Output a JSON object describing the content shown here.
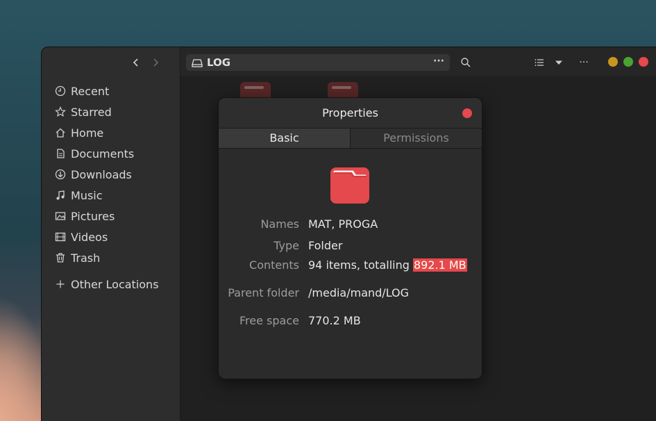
{
  "sidebar": {
    "places": [
      {
        "label": "Recent",
        "icon": "clock-icon"
      },
      {
        "label": "Starred",
        "icon": "star-icon"
      },
      {
        "label": "Home",
        "icon": "home-icon"
      },
      {
        "label": "Documents",
        "icon": "document-icon"
      },
      {
        "label": "Downloads",
        "icon": "download-icon"
      },
      {
        "label": "Music",
        "icon": "music-icon"
      },
      {
        "label": "Pictures",
        "icon": "picture-icon"
      },
      {
        "label": "Videos",
        "icon": "video-icon"
      },
      {
        "label": "Trash",
        "icon": "trash-icon"
      }
    ],
    "other_locations": {
      "label": "Other Locations",
      "icon": "plus-icon"
    }
  },
  "headerbar": {
    "path": "LOG",
    "path_more": "···",
    "menu_more": "···"
  },
  "dialog": {
    "title": "Properties",
    "tabs": [
      "Basic",
      "Permissions"
    ],
    "active_tab": "Basic",
    "rows": {
      "names_label": "Names",
      "names_value": "MAT, PROGA",
      "type_label": "Type",
      "type_value": "Folder",
      "contents_label": "Contents",
      "contents_prefix": "94 items, totalling",
      "contents_size": "892.1 MB",
      "parent_label": "Parent folder",
      "parent_value": "/media/mand/LOG",
      "free_label": "Free space",
      "free_value": "770.2 MB"
    }
  },
  "colors": {
    "accent": "#e5484d",
    "window_bg": "#232323",
    "sidebar_bg": "#2d2d2d",
    "minimize": "#c8961e",
    "maximize": "#4aa433",
    "close": "#e5484d"
  }
}
